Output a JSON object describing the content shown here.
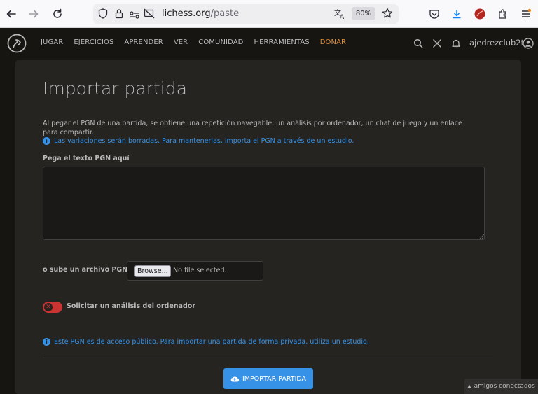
{
  "browser": {
    "url_domain": "lichess.org",
    "url_path": "/paste",
    "zoom": "80%"
  },
  "header": {
    "nav": [
      "JUGAR",
      "EJERCICIOS",
      "APRENDER",
      "VER",
      "COMUNIDAD",
      "HERRAMIENTAS",
      "DONAR"
    ],
    "username": "ajedrezclub2t"
  },
  "main": {
    "title": "Importar partida",
    "intro": "Al pegar el PGN de una partida, se obtiene una repetición navegable, un análisis por ordenador, un chat de juego y un enlace para compartir.",
    "variations_note": "Las variaciones serán borradas. Para mantenerlas, importa el PGN a través de un estudio.",
    "pgn_label": "Pega el texto PGN aquí",
    "pgn_value": "",
    "file_label": "o sube un archivo PGN",
    "browse_label": "Browse...",
    "no_file_label": "No file selected.",
    "analysis_label": "Solicitar un análisis del ordenador",
    "analysis_enabled": false,
    "public_note": "Este PGN es de acceso público. Para importar una partida de forma privada, utiliza un estudio.",
    "import_button": "IMPORTAR PARTIDA"
  },
  "friends_tab": "amigos conectados",
  "colors": {
    "accent": "#3692e7",
    "donate": "#e08c35",
    "toggle_off": "#cc3333",
    "background": "#161512",
    "panel": "#262421"
  }
}
